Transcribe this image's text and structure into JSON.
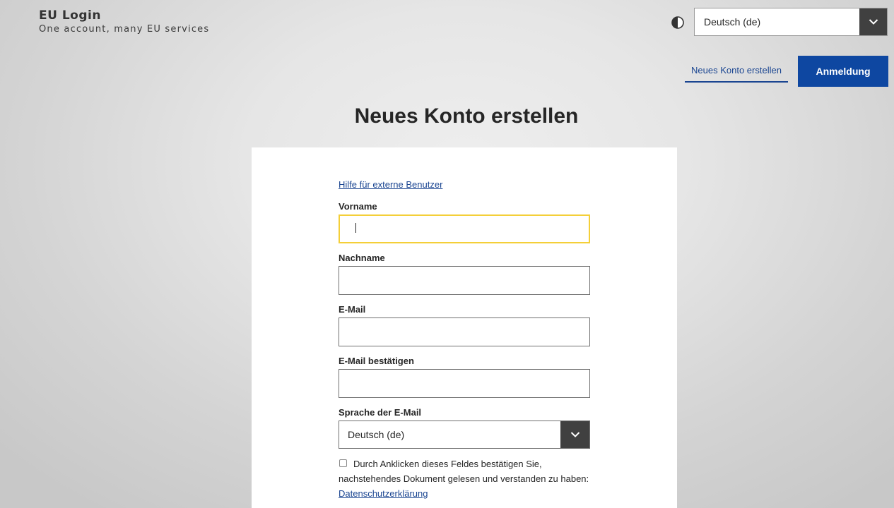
{
  "header": {
    "app_title": "EU Login",
    "tagline": "One account, many EU services",
    "contrast_icon": "contrast-icon",
    "language_select": {
      "value": "Deutsch (de)",
      "icon": "chevron-down-icon"
    },
    "nav": {
      "create_account": "Neues Konto erstellen",
      "login": "Anmeldung"
    }
  },
  "page": {
    "title": "Neues Konto erstellen"
  },
  "form": {
    "help_link": "Hilfe für externe Benutzer",
    "first_name": {
      "label": "Vorname",
      "value": "",
      "focused": true
    },
    "last_name": {
      "label": "Nachname",
      "value": ""
    },
    "email": {
      "label": "E-Mail",
      "value": ""
    },
    "email_confirm": {
      "label": "E-Mail bestätigen",
      "value": ""
    },
    "email_language": {
      "label": "Sprache der E-Mail",
      "value": "Deutsch (de)"
    },
    "consent": {
      "checked": false,
      "text": "Durch Anklicken dieses Feldes bestätigen Sie, nachstehendes Dokument gelesen und verstanden zu haben: ",
      "link": "Datenschutzerklärung"
    }
  },
  "colors": {
    "primary_button": "#0e47a1",
    "link": "#1a4591",
    "focus_border": "#f4cf38",
    "select_chevron_bg": "#404040"
  }
}
